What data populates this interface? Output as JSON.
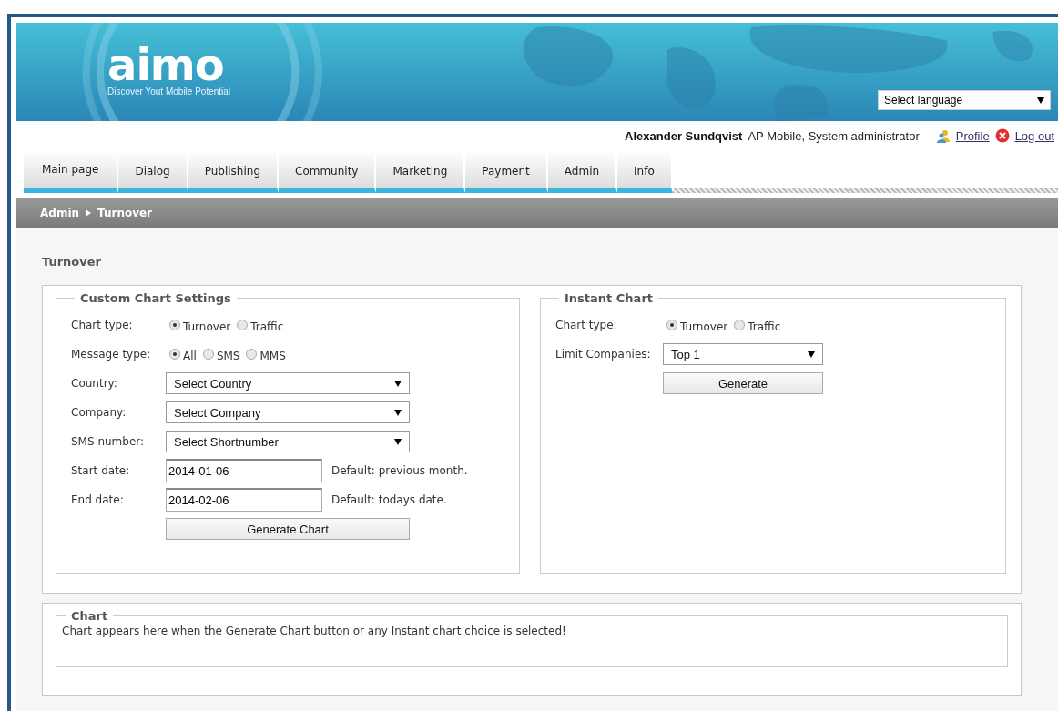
{
  "header": {
    "logo": "aimo",
    "tagline": "Discover Yout Mobile Potential",
    "language_select": {
      "value": "Select language"
    }
  },
  "user_bar": {
    "name": "Alexander Sundqvist",
    "role": "AP Mobile, System administrator",
    "profile_link": "Profile",
    "logout_link": "Log out"
  },
  "nav": {
    "items": [
      "Main page",
      "Dialog",
      "Publishing",
      "Community",
      "Marketing",
      "Payment",
      "Admin",
      "Info"
    ]
  },
  "breadcrumb": [
    "Admin",
    "Turnover"
  ],
  "page_title": "Turnover",
  "custom_settings": {
    "legend": "Custom Chart Settings",
    "rows": [
      {
        "kind": "radio",
        "label": "Chart type:",
        "options": [
          {
            "label": "Turnover",
            "selected": true
          },
          {
            "label": "Traffic",
            "selected": false
          }
        ]
      },
      {
        "kind": "radio",
        "label": "Message type:",
        "options": [
          {
            "label": "All",
            "selected": true
          },
          {
            "label": "SMS",
            "selected": false
          },
          {
            "label": "MMS",
            "selected": false
          }
        ]
      },
      {
        "kind": "select",
        "label": "Country:",
        "value": "Select Country"
      },
      {
        "kind": "select",
        "label": "Company:",
        "value": "Select Company"
      },
      {
        "kind": "select",
        "label": "SMS number:",
        "value": "Select Shortnumber"
      },
      {
        "kind": "date",
        "label": "Start date:",
        "value": "2014-01-06",
        "hint": "Default: previous month."
      },
      {
        "kind": "date",
        "label": "End date:",
        "value": "2014-02-06",
        "hint": "Default: todays date."
      },
      {
        "kind": "button",
        "label": "Generate Chart"
      }
    ]
  },
  "instant_chart": {
    "legend": "Instant Chart",
    "rows": [
      {
        "kind": "radio",
        "label": "Chart type:",
        "options": [
          {
            "label": "Turnover",
            "selected": true
          },
          {
            "label": "Traffic",
            "selected": false
          }
        ]
      },
      {
        "kind": "select",
        "label": "Limit Companies:",
        "value": "Top 1"
      },
      {
        "kind": "button",
        "label": "Generate"
      }
    ]
  },
  "chart": {
    "legend": "Chart",
    "message": "Chart appears here when the Generate Chart button or any Instant chart choice is selected!"
  }
}
